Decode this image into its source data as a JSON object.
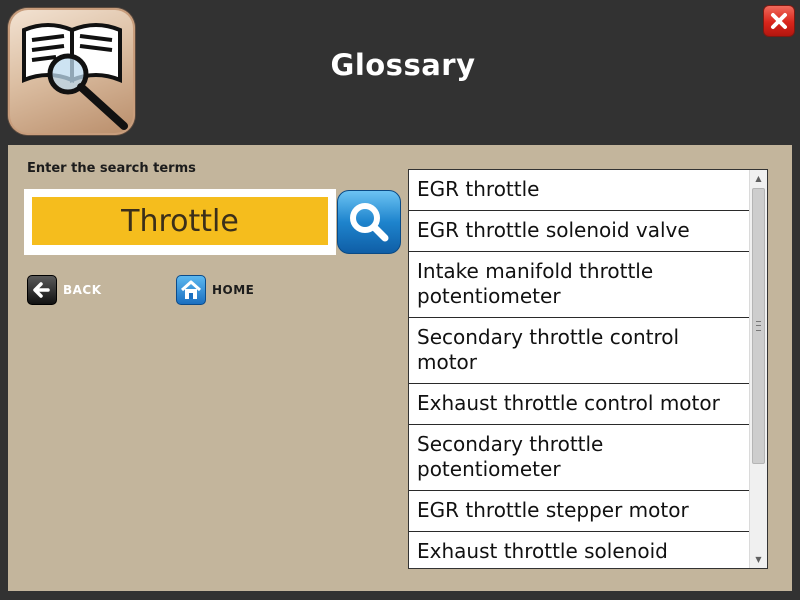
{
  "window": {
    "title": "Glossary",
    "app_icon": "glossary-book-magnifier-icon",
    "close_icon": "close-icon"
  },
  "search": {
    "label": "Enter the search terms",
    "value": "Throttle",
    "button_icon": "search-icon"
  },
  "nav": {
    "back_label": "BACK",
    "back_icon": "back-arrow-icon",
    "home_label": "HOME",
    "home_icon": "home-icon"
  },
  "results": [
    "EGR throttle",
    "EGR throttle solenoid valve",
    "Intake manifold throttle potentiometer",
    "Secondary throttle control motor",
    "Exhaust throttle control motor",
    "Secondary throttle potentiometer",
    "EGR throttle stepper motor",
    "Exhaust throttle solenoid"
  ],
  "colors": {
    "background": "#323232",
    "panel": "#c3b59c",
    "search_field": "#f5bd1d",
    "search_button": "#1e84cd",
    "close_button": "#d8251b"
  }
}
